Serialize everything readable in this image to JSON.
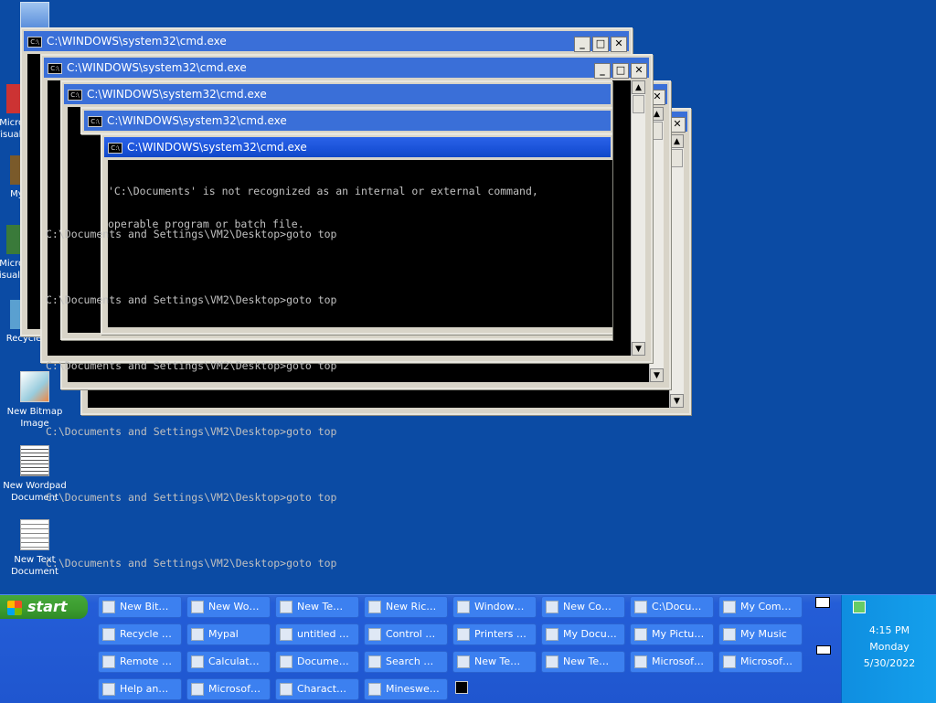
{
  "desktop_icons": [
    {
      "label": "My",
      "icon": "computer-icon"
    },
    {
      "label": "Microsoft Visual C++",
      "icon": "visual-cpp-icon"
    },
    {
      "label": "Mypal",
      "icon": "mypal-icon"
    },
    {
      "label": "Microsoft Visual Basic",
      "icon": "visual-basic-icon"
    },
    {
      "label": "Recycle",
      "icon": "recycle-bin-icon"
    },
    {
      "label": "New Bitmap Image",
      "icon": "bitmap-icon"
    },
    {
      "label": "New Wordpad Document",
      "icon": "wordpad-icon"
    },
    {
      "label": "New Text Document",
      "icon": "text-document-icon"
    }
  ],
  "windows": [
    {
      "title": "C:\\WINDOWS\\system32\\cmd.exe"
    },
    {
      "title": "C:\\WINDOWS\\system32\\cmd.exe"
    },
    {
      "title": "C:\\WINDOWS\\system32\\cmd.exe"
    },
    {
      "title": "C:\\WINDOWS\\system32\\cmd.exe"
    },
    {
      "title": "C:\\WINDOWS\\system32\\cmd.exe"
    }
  ],
  "console": {
    "error_line1": "'C:\\Documents' is not recognized as an internal or external command,",
    "error_line2": "operable program or batch file.",
    "prompt_line": "C:\\Documents and Settings\\VM2\\Desktop>goto top"
  },
  "taskbar": {
    "start_label": "start",
    "buttons": [
      "New Bit…",
      "New Wo…",
      "New Te…",
      "New Ric…",
      "Window…",
      "New Co…",
      "C:\\Docu…",
      "My Com…",
      "Recycle …",
      "Mypal",
      "untitled …",
      "Control …",
      "Printers …",
      "My Docu…",
      "My Pictu…",
      "My Music",
      "Remote …",
      "Calculat…",
      "Docume…",
      "Search …",
      "New Te…",
      "New Te…",
      "Microsof…",
      "Microsof…",
      "Help an…",
      "Microsof…",
      "Charact…",
      "Mineswe…"
    ],
    "cmd_button_label": "C:\\"
  },
  "tray": {
    "time": "4:15 PM",
    "day": "Monday",
    "date": "5/30/2022"
  },
  "colors": {
    "desktop": "#0b4ba4",
    "taskbar": "#245dd7",
    "start": "#3b9b2f",
    "titlebar_active": "#1a52d8"
  }
}
